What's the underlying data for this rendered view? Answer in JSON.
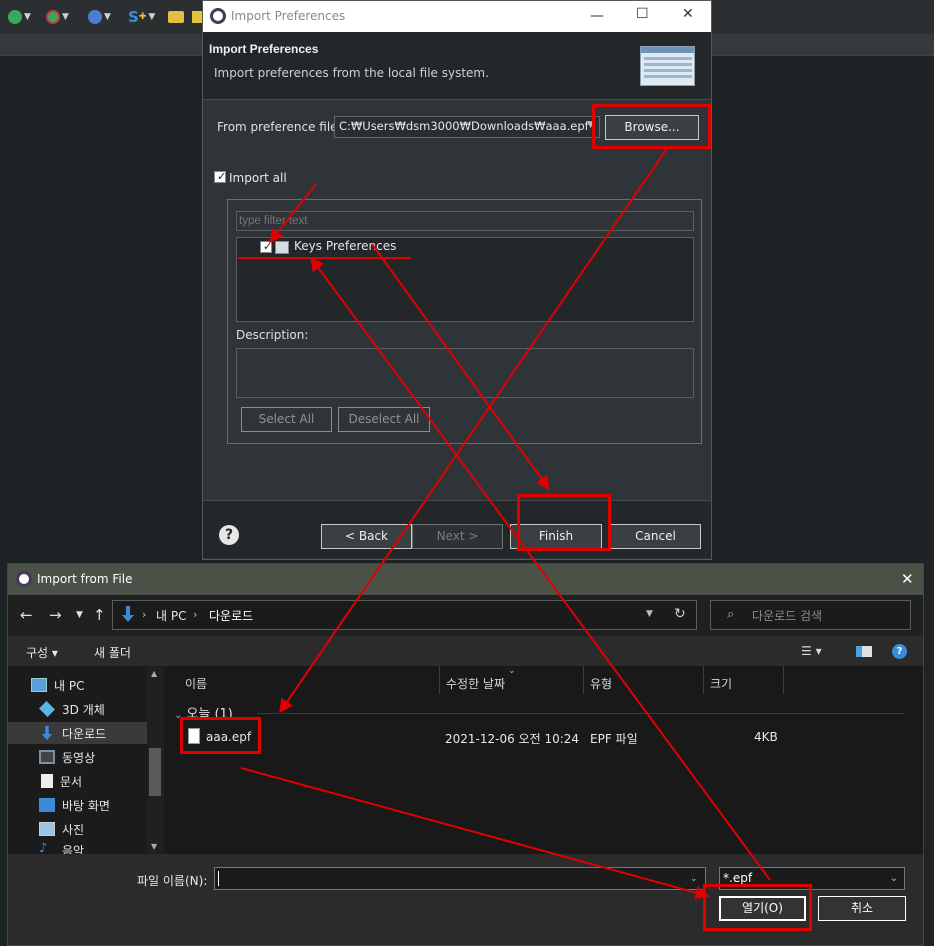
{
  "colors": {
    "annotation_red": "#e00000",
    "accent_blue": "#3b8bd8",
    "dialog_bg": "#2f3438"
  },
  "pref_dialog": {
    "title": "Import Preferences",
    "heading": "Import Preferences",
    "subheading": "Import preferences from the local file system.",
    "from_label": "From preference file:",
    "from_value": "C:₩Users₩dsm3000₩Downloads₩aaa.epf",
    "browse_label": "Browse...",
    "import_all_label": "Import all",
    "import_all_checked": true,
    "filter_placeholder": "type filter text",
    "tree_item_label": "Keys Preferences",
    "tree_item_checked": true,
    "description_label": "Description:",
    "select_all_label": "Select All",
    "deselect_all_label": "Deselect All",
    "back_label": "< Back",
    "next_label": "Next >",
    "finish_label": "Finish",
    "cancel_label": "Cancel",
    "help_glyph": "?"
  },
  "file_dialog": {
    "title": "Import from File",
    "address": {
      "pc": "내 PC",
      "folder": "다운로드"
    },
    "search_placeholder": "다운로드 검색",
    "organize_label": "구성 ▾",
    "new_folder_label": "새 폴더",
    "nav_items": [
      {
        "label": "내 PC",
        "icon": "pc-icon"
      },
      {
        "label": "3D 개체",
        "icon": "cube-icon"
      },
      {
        "label": "다운로드",
        "icon": "download-icon"
      },
      {
        "label": "동영상",
        "icon": "video-icon"
      },
      {
        "label": "문서",
        "icon": "document-icon"
      },
      {
        "label": "바탕 화면",
        "icon": "desktop-icon"
      },
      {
        "label": "사진",
        "icon": "picture-icon"
      },
      {
        "label": "음악",
        "icon": "music-icon"
      }
    ],
    "columns": [
      "이름",
      "수정한 날짜",
      "유형",
      "크기"
    ],
    "group_header": "오늘 (1)",
    "files": [
      {
        "name": "aaa.epf",
        "modified": "2021-12-06 오전 10:24",
        "type": "EPF 파일",
        "size": "4KB"
      }
    ],
    "filename_label": "파일 이름(N):",
    "filename_value": "",
    "filter_value": "*.epf",
    "open_label": "열기(O)",
    "cancel_label": "취소"
  }
}
